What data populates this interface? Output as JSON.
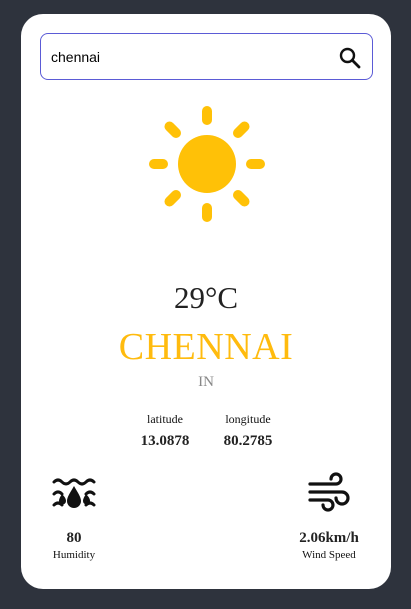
{
  "search": {
    "value": "chennai",
    "placeholder": "",
    "button_icon": "search-icon"
  },
  "weather": {
    "icon": "sun-icon",
    "temperature": "29°C",
    "city": "CHENNAI",
    "country": "IN"
  },
  "coordinates": {
    "latitude_label": "latitude",
    "latitude_value": "13.0878",
    "longitude_label": "longitude",
    "longitude_value": "80.2785"
  },
  "humidity": {
    "icon": "humidity-icon",
    "value": "80",
    "label": "Humidity"
  },
  "wind": {
    "icon": "wind-icon",
    "value": "2.06km/h",
    "label": "Wind Speed"
  },
  "colors": {
    "background": "#2e333d",
    "card": "#ffffff",
    "accent": "#ffbb0e",
    "search_border": "#5b5bd6"
  }
}
